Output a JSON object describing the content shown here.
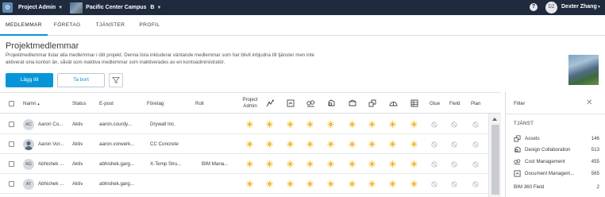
{
  "topbar": {
    "module_name": "Project Admin",
    "project_name": "Pacific Center Campus",
    "project_badge": "B",
    "help": "?",
    "user_initials": "DZ",
    "user_name": "Dexter Zhang"
  },
  "tabs": [
    {
      "label": "MEDLEMMAR",
      "active": true
    },
    {
      "label": "FÖRETAG",
      "active": false
    },
    {
      "label": "TJÄNSTER",
      "active": false
    },
    {
      "label": "PROFIL",
      "active": false
    }
  ],
  "page": {
    "title": "Projektmedlemmar",
    "description": "Projektmedlemmar listar alla medlemmar i ditt projekt. Denna lista inkluderar väntande medlemmar som har blivit inbjudna till tjänster men inte aktiverat sina konton än, såväl som inaktiva medlemmar som inaktiverades av en kontoadministratör."
  },
  "actions": {
    "add_label": "Lägg till",
    "remove_label": "Ta bort"
  },
  "table": {
    "columns": {
      "name": "Namn",
      "sort_indicator": "▲",
      "status": "Status",
      "email": "E-post",
      "company": "Företag",
      "role": "Roll",
      "project_admin_line1": "Project",
      "project_admin_line2": "Admin",
      "glue": "Glue",
      "field": "Field",
      "plan": "Plan"
    },
    "service_icons": [
      "insights-icon",
      "document-management-icon",
      "cost-management-icon",
      "design-collaboration-icon",
      "model-coordination-icon",
      "assets-icon",
      "bim360-field-icon",
      "project-management-icon"
    ],
    "rows": [
      {
        "initials": "AC",
        "photo": false,
        "name": "Aaron Co...",
        "status": "Aktiv",
        "email": "aaron.courdy...",
        "company": "Drywall Inc.",
        "role": ""
      },
      {
        "initials": "",
        "photo": true,
        "name": "Aaron Vor...",
        "status": "Aktiv",
        "email": "aaron.vorwerk...",
        "company": "CC Concrete",
        "role": ""
      },
      {
        "initials": "AG",
        "photo": false,
        "name": "Abhishek ...",
        "status": "Aktiv",
        "email": "abhishek.garg...",
        "company": "X-Temp Stru...",
        "role": "BIM Mana..."
      },
      {
        "initials": "AT",
        "photo": false,
        "name": "Abhishek ...",
        "status": "Aktiv",
        "email": "abhishek.garg...",
        "company": "",
        "role": ""
      }
    ]
  },
  "filter": {
    "title": "Filter",
    "section": "TJÄNST",
    "items": [
      {
        "label": "Assets",
        "count": "146",
        "icon": "assets-icon"
      },
      {
        "label": "Design Collaboration",
        "count": "513",
        "icon": "design-collaboration-icon"
      },
      {
        "label": "Cost Management",
        "count": "455",
        "icon": "cost-management-icon"
      },
      {
        "label": "Document Managem...",
        "count": "565",
        "icon": "document-management-icon"
      },
      {
        "label": "BIM 360 Field",
        "count": "2",
        "icon": ""
      }
    ]
  },
  "colors": {
    "topbar": "#1f2a3c",
    "accent": "#0696d7",
    "active_service": "#f5b21a",
    "inactive_service": "#b5b9be"
  }
}
